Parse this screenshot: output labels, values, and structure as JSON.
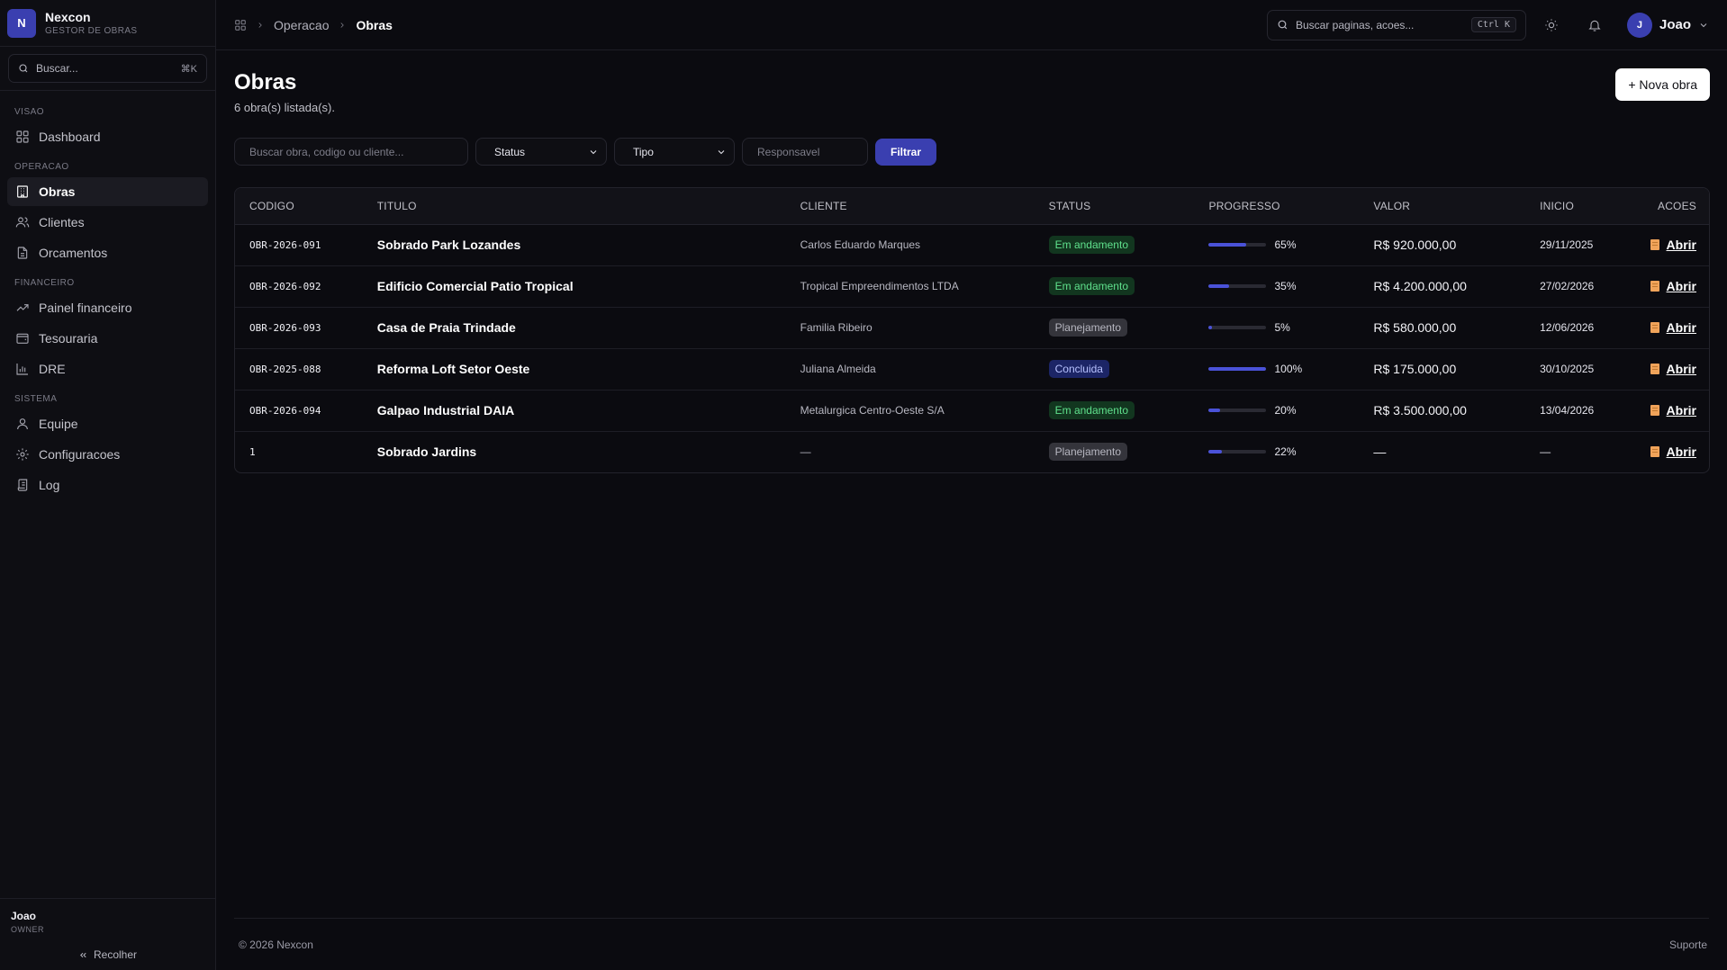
{
  "brand": {
    "logo_letter": "N",
    "name": "Nexcon",
    "subtitle": "GESTOR DE OBRAS"
  },
  "sidebar": {
    "search_placeholder": "Buscar...",
    "search_shortcut": "⌘K",
    "groups": [
      {
        "label": "VISAO",
        "items": [
          {
            "label": "Dashboard",
            "icon": "dashboard-icon"
          }
        ]
      },
      {
        "label": "OPERACAO",
        "items": [
          {
            "label": "Obras",
            "icon": "building-icon",
            "active": true
          },
          {
            "label": "Clientes",
            "icon": "users-icon"
          },
          {
            "label": "Orcamentos",
            "icon": "file-icon"
          }
        ]
      },
      {
        "label": "FINANCEIRO",
        "items": [
          {
            "label": "Painel financeiro",
            "icon": "trending-icon"
          },
          {
            "label": "Tesouraria",
            "icon": "wallet-icon"
          },
          {
            "label": "DRE",
            "icon": "bar-chart-icon"
          }
        ]
      },
      {
        "label": "SISTEMA",
        "items": [
          {
            "label": "Equipe",
            "icon": "user-icon"
          },
          {
            "label": "Configuracoes",
            "icon": "gear-icon"
          },
          {
            "label": "Log",
            "icon": "log-icon"
          }
        ]
      }
    ],
    "user_name": "Joao",
    "user_role": "OWNER",
    "collapse_label": "Recolher"
  },
  "topbar": {
    "breadcrumb": [
      "Operacao",
      "Obras"
    ],
    "search_placeholder": "Buscar paginas, acoes...",
    "search_shortcut": "Ctrl K",
    "user_initial": "J",
    "user_name": "Joao"
  },
  "page": {
    "title": "Obras",
    "subtitle": "6 obra(s) listada(s).",
    "new_button": "+ Nova obra"
  },
  "filters": {
    "search_placeholder": "Buscar obra, codigo ou cliente...",
    "status_label": "Status",
    "tipo_label": "Tipo",
    "responsavel_placeholder": "Responsavel",
    "filter_button": "Filtrar"
  },
  "table": {
    "headers": [
      "CODIGO",
      "TITULO",
      "CLIENTE",
      "STATUS",
      "PROGRESSO",
      "VALOR",
      "INICIO",
      "ACOES"
    ],
    "rows": [
      {
        "code": "OBR-2026-091",
        "title": "Sobrado Park Lozandes",
        "client": "Carlos Eduardo Marques",
        "status": "Em andamento",
        "status_kind": "green",
        "progress": 65,
        "progress_label": "65%",
        "value": "R$ 920.000,00",
        "start": "29/11/2025",
        "action": "Abrir"
      },
      {
        "code": "OBR-2026-092",
        "title": "Edificio Comercial Patio Tropical",
        "client": "Tropical Empreendimentos LTDA",
        "status": "Em andamento",
        "status_kind": "green",
        "progress": 35,
        "progress_label": "35%",
        "value": "R$ 4.200.000,00",
        "start": "27/02/2026",
        "action": "Abrir"
      },
      {
        "code": "OBR-2026-093",
        "title": "Casa de Praia Trindade",
        "client": "Familia Ribeiro",
        "status": "Planejamento",
        "status_kind": "gray",
        "progress": 5,
        "progress_label": "5%",
        "value": "R$ 580.000,00",
        "start": "12/06/2026",
        "action": "Abrir"
      },
      {
        "code": "OBR-2025-088",
        "title": "Reforma Loft Setor Oeste",
        "client": "Juliana Almeida",
        "status": "Concluida",
        "status_kind": "blue",
        "progress": 100,
        "progress_label": "100%",
        "value": "R$ 175.000,00",
        "start": "30/10/2025",
        "action": "Abrir"
      },
      {
        "code": "OBR-2026-094",
        "title": "Galpao Industrial DAIA",
        "client": "Metalurgica Centro-Oeste S/A",
        "status": "Em andamento",
        "status_kind": "green",
        "progress": 20,
        "progress_label": "20%",
        "value": "R$ 3.500.000,00",
        "start": "13/04/2026",
        "action": "Abrir"
      },
      {
        "code": "1",
        "title": "Sobrado Jardins",
        "client": "—",
        "status": "Planejamento",
        "status_kind": "gray",
        "progress": 22,
        "progress_label": "22%",
        "value": "—",
        "start": "—",
        "action": "Abrir"
      }
    ]
  },
  "footer": {
    "copyright": "© 2026 Nexcon",
    "support": "Suporte"
  },
  "colors": {
    "accent": "#3a3fb0",
    "progress": "#4a52d8",
    "background": "#0b0b10"
  }
}
